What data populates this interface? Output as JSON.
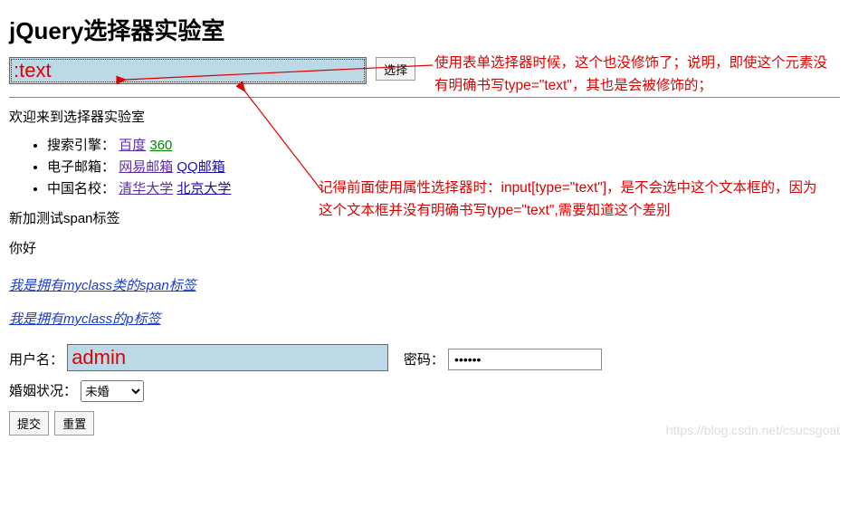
{
  "heading": "jQuery选择器实验室",
  "selector_input": {
    "value": ":text"
  },
  "select_button": "选择",
  "welcome": "欢迎来到选择器实验室",
  "list": [
    {
      "label": "搜索引擎：",
      "links": [
        {
          "text": "百度",
          "cls": "purple-link"
        },
        {
          "text": "360",
          "cls": "green-link"
        }
      ]
    },
    {
      "label": "电子邮箱：",
      "links": [
        {
          "text": "网易邮箱",
          "cls": "purple-link"
        },
        {
          "text": "QQ邮箱",
          "cls": "blue-link"
        }
      ]
    },
    {
      "label": "中国名校：",
      "links": [
        {
          "text": "清华大学",
          "cls": "purple-link"
        },
        {
          "text": "北京大学",
          "cls": "blue-link"
        }
      ]
    }
  ],
  "span_test": "新加测试span标签",
  "hello": "你好",
  "myclass_span": "我是拥有myclass类的span标签",
  "myclass_p": "我是拥有myclass的p标签",
  "username_label": "用户名：",
  "username_value": "admin",
  "password_label": "密码：",
  "password_value": "••••••",
  "marital_label": "婚姻状况：",
  "marital_option": "未婚",
  "submit_btn": "提交",
  "reset_btn": "重置",
  "annotation1": "使用表单选择器时候，这个也没修饰了；说明，即使这个元素没有明确书写type=\"text\"，其也是会被修饰的；",
  "annotation2": "记得前面使用属性选择器时：input[type=\"text\"]，是不会选中这个文本框的，因为这个文本框并没有明确书写type=\"text\",需要知道这个差别",
  "watermark": "https://blog.csdn.net/csucsgoat"
}
